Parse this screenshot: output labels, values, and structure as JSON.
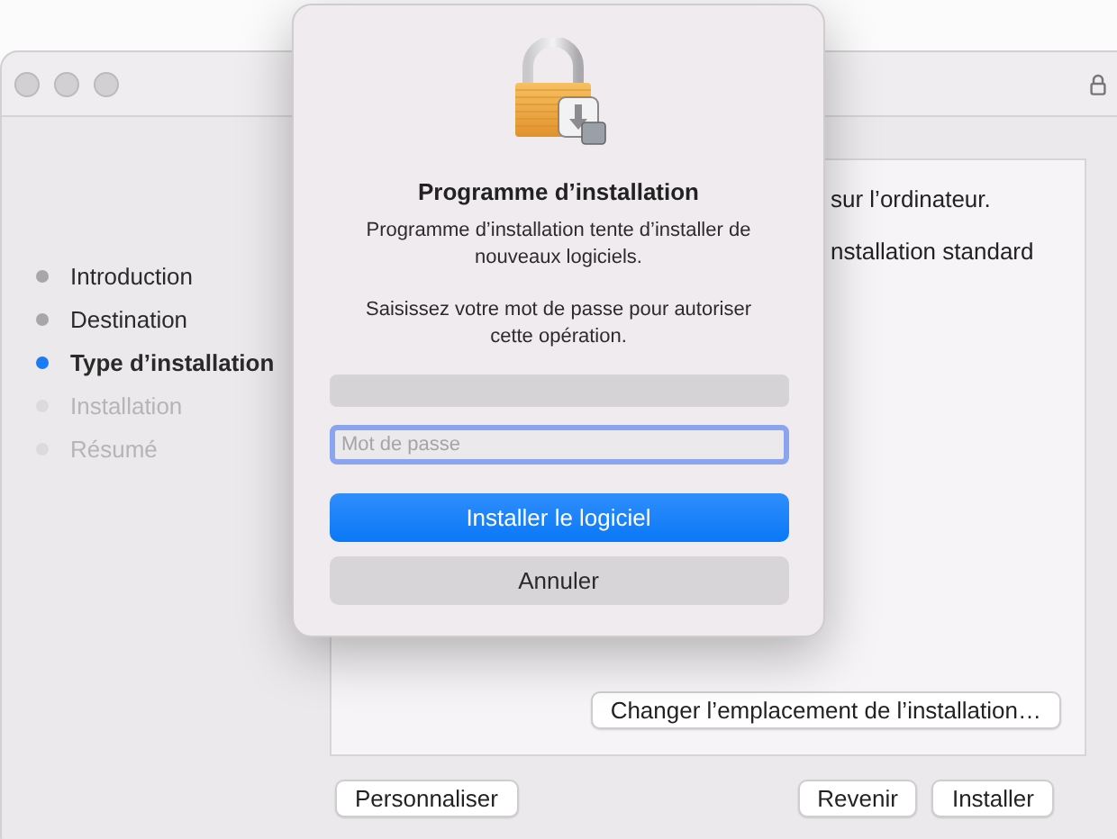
{
  "window": {
    "locked": true
  },
  "steps": [
    {
      "label": "Introduction",
      "kind": "done"
    },
    {
      "label": "Destination",
      "kind": "done"
    },
    {
      "label": "Type d’installation",
      "kind": "current"
    },
    {
      "label": "Installation",
      "kind": "upcoming"
    },
    {
      "label": "Résumé",
      "kind": "upcoming"
    }
  ],
  "content": {
    "lines": [
      "sur l’ordinateur.",
      "nstallation standard"
    ],
    "change_location_button": "Changer l’emplacement de l’installation…"
  },
  "footer": {
    "left_buttons": [
      "Personnaliser"
    ],
    "right_buttons": [
      "Revenir",
      "Installer"
    ]
  },
  "dialog": {
    "title": "Programme d’installation",
    "message": "Programme d’installation tente d’installer de nouveaux logiciels.",
    "prompt": "Saisissez votre mot de passe pour autoriser cette opération.",
    "name_field": {
      "disabled": true
    },
    "password_field": {
      "placeholder": "Mot de passe",
      "focused": true
    },
    "buttons": [
      {
        "label": "Installer le logiciel",
        "kind": "primary"
      },
      {
        "label": "Annuler",
        "kind": "secondary"
      }
    ]
  }
}
